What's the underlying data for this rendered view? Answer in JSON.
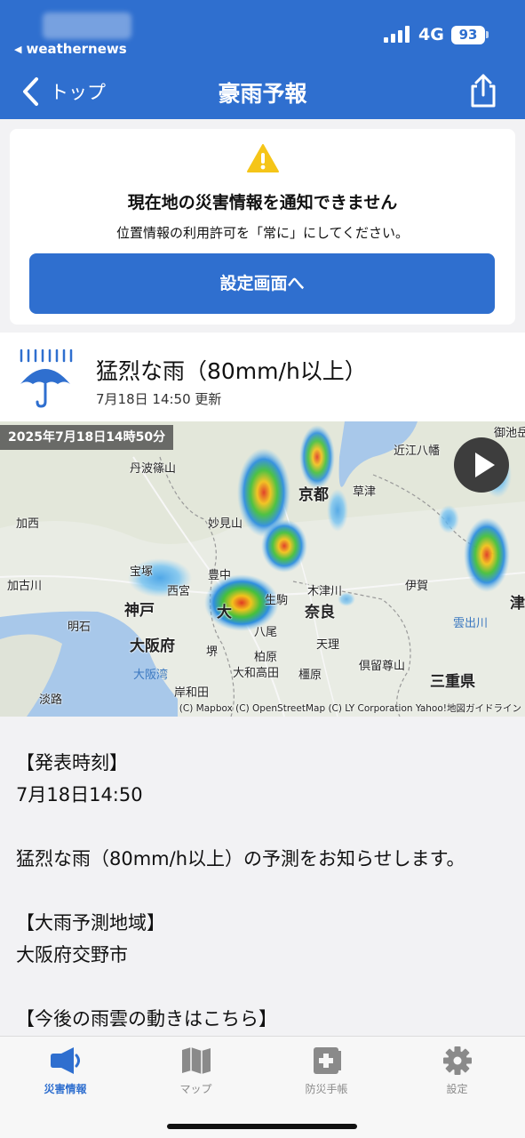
{
  "status_bar": {
    "back_app": "weathernews",
    "network": "4G",
    "battery": "93"
  },
  "nav": {
    "back_label": "トップ",
    "title": "豪雨予報"
  },
  "alert": {
    "title": "現在地の災害情報を通知できません",
    "message": "位置情報の利用許可を「常に」にしてください。",
    "button": "設定画面へ"
  },
  "info": {
    "title": "猛烈な雨（80mm/h以上）",
    "updated": "7月18日 14:50 更新"
  },
  "map": {
    "timestamp": "2025年7月18日14時50分",
    "credit": "(C) Mapbox (C) OpenStreetMap (C) LY Corporation Yahoo!地図ガイドライン",
    "labels": {
      "mikuni": "御池岳",
      "tamba": "丹波篠山",
      "kyoto": "京都",
      "kusatsu": "草津",
      "omihachiman": "近江八幡",
      "kasai": "加西",
      "myoken": "妙見山",
      "kakogawa": "加古川",
      "takarazuka": "宝塚",
      "nishinomiya": "西宮",
      "toyonaka": "豊中",
      "kizugawa": "木津川",
      "iga": "伊賀",
      "tsu": "津",
      "kobe": "神戸",
      "osaka_short": "大",
      "nara": "奈良",
      "akashi": "明石",
      "yao": "八尾",
      "osakafu": "大阪府",
      "sakai": "堺",
      "tenri": "天理",
      "ureshino": "雲出川",
      "osakawan": "大阪湾",
      "yamatotakada": "大和高田",
      "kashihara": "柏原",
      "kashiwara": "橿原",
      "sonibuso": "倶留尊山",
      "kishiwada": "岸和田",
      "mie": "三重県",
      "awaji": "淡路",
      "ikoma": "生駒"
    }
  },
  "body": {
    "time_heading": "【発表時刻】",
    "time_value": "7月18日14:50",
    "message": "猛烈な雨（80mm/h以上）の予測をお知らせします。",
    "area_heading": "【大雨予測地域】",
    "area_value": "大阪府交野市",
    "next_heading": "【今後の雨雲の動きはこちら】"
  },
  "tabs": [
    {
      "label": "災害情報",
      "icon": "megaphone-icon",
      "active": true
    },
    {
      "label": "マップ",
      "icon": "map-icon",
      "active": false
    },
    {
      "label": "防災手帳",
      "icon": "first-aid-book-icon",
      "active": false
    },
    {
      "label": "設定",
      "icon": "gear-icon",
      "active": false
    }
  ],
  "colors": {
    "brand_blue": "#2f6fcf",
    "warning_yellow": "#f5c518",
    "inactive_tab": "#8a8a8a"
  }
}
